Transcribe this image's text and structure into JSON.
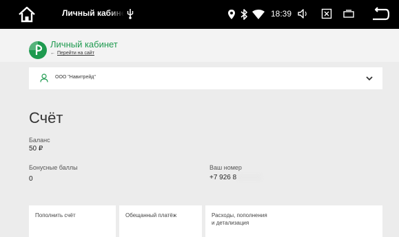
{
  "statusbar": {
    "title": "Личный кабинет",
    "time": "18:39",
    "icons": [
      "home-icon",
      "usb-icon",
      "location-icon",
      "bluetooth-icon",
      "wifi-icon",
      "volume-icon",
      "screenshot-icon",
      "window-icon",
      "back-icon"
    ]
  },
  "header": {
    "title": "Личный кабинет",
    "link_arrow": "←",
    "link_text": "Перейти на сайт",
    "brand_color": "#1e9a4f"
  },
  "account_select": {
    "selected": "ООО \"Навитрейд\""
  },
  "main": {
    "title": "Счёт",
    "balance_label": "Баланс",
    "balance_value": "50 ₽",
    "bonus_label": "Бонусные баллы",
    "bonus_value": "0",
    "number_label": "Ваш номер",
    "number_value": "+7 926 8"
  },
  "cards": [
    {
      "label": "Пополнить счёт"
    },
    {
      "label": "Обещанный платёж"
    },
    {
      "label": "Расходы, пополнения\nи детализация"
    }
  ]
}
